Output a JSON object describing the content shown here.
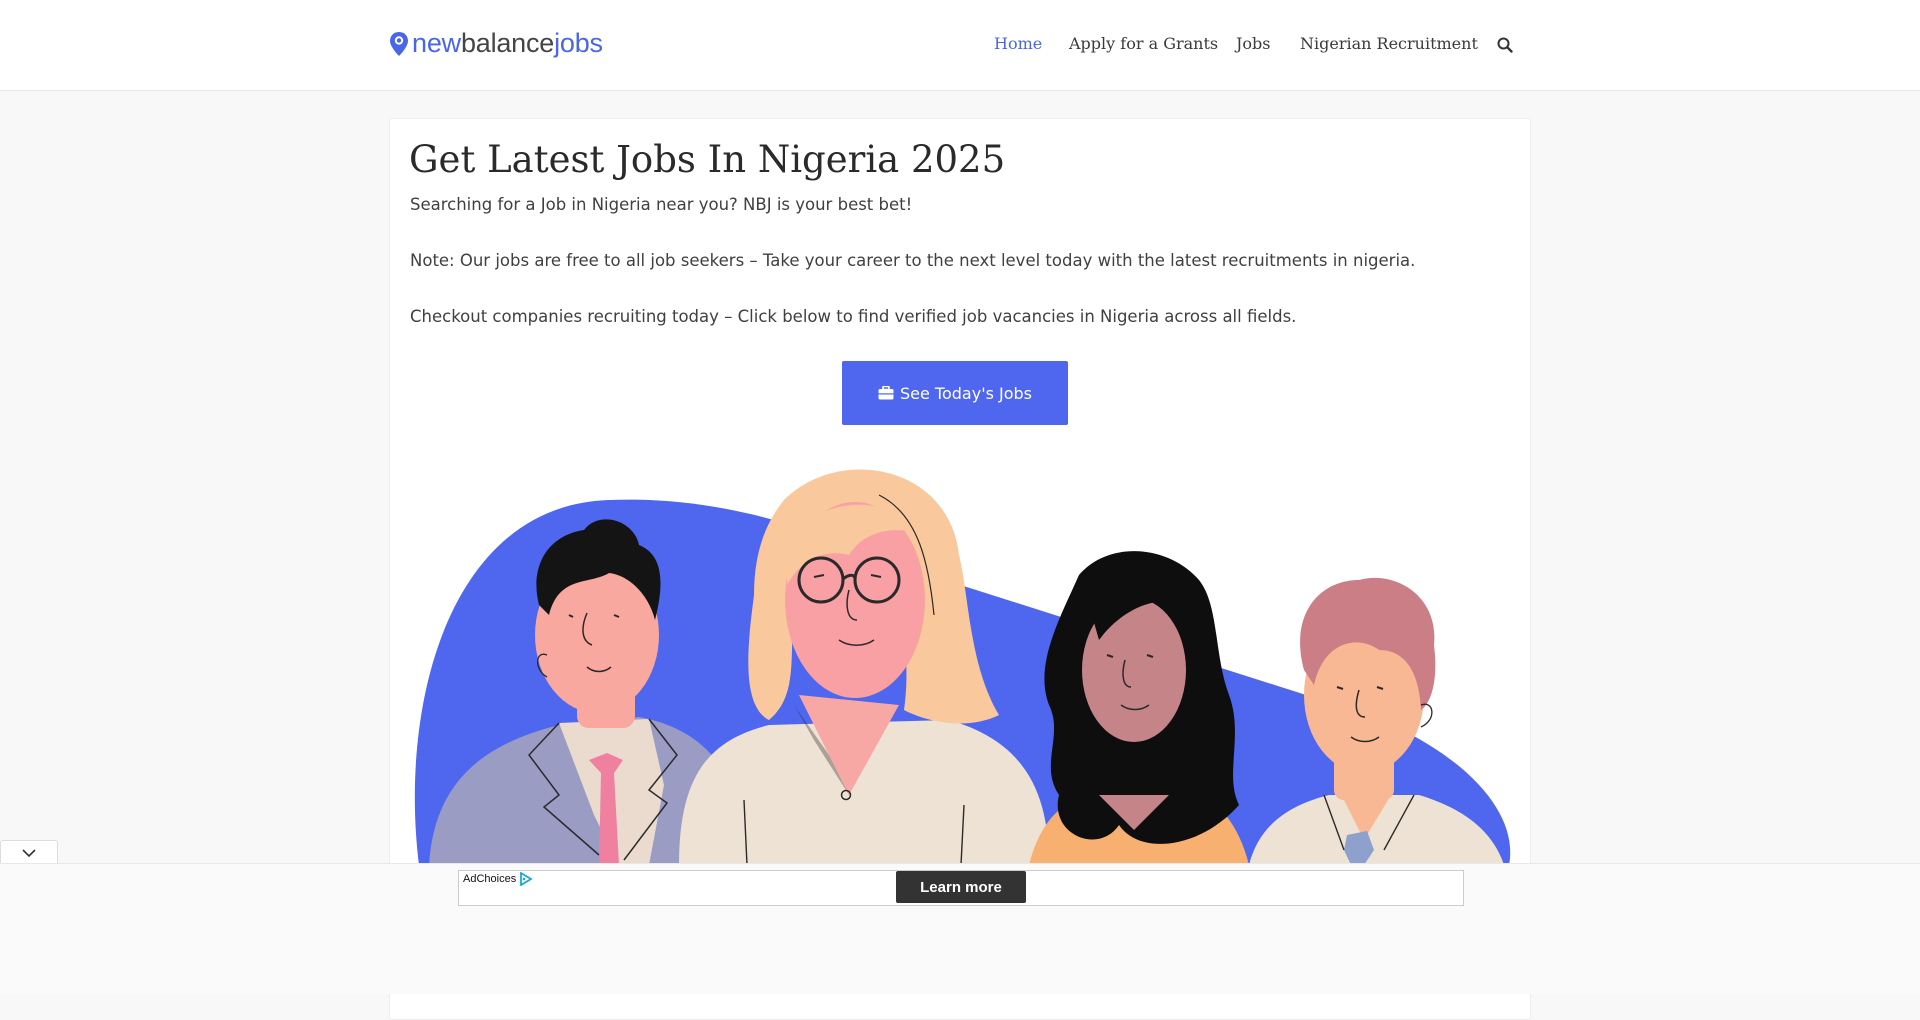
{
  "header": {
    "logo": {
      "part1": "new",
      "part2": "balance",
      "part3": "jobs"
    },
    "nav": [
      {
        "label": "Home",
        "active": true
      },
      {
        "label": "Apply for a Grants",
        "active": false
      },
      {
        "label": "Jobs",
        "active": false
      },
      {
        "label": "Nigerian Recruitment",
        "active": false
      }
    ],
    "search_icon": "search-icon"
  },
  "main": {
    "title": "Get Latest Jobs In Nigeria 2025",
    "paragraphs": [
      "Searching for a Job in Nigeria near you? NBJ is your best bet!",
      "Note: Our jobs are free to all job seekers – Take your career to the next level today with the latest recruitments in nigeria.",
      "Checkout companies recruiting today – Click below to find verified job vacancies in Nigeria across all fields."
    ],
    "cta": {
      "label": "See Today's Jobs",
      "icon": "briefcase-icon"
    }
  },
  "ad": {
    "adchoices_label": "AdChoices",
    "learn_more": "Learn more",
    "collapse_icon": "chevron-down-icon"
  },
  "colors": {
    "accent": "#4a66e8",
    "button": "#4f66ee",
    "blob": "#4f66ee"
  }
}
